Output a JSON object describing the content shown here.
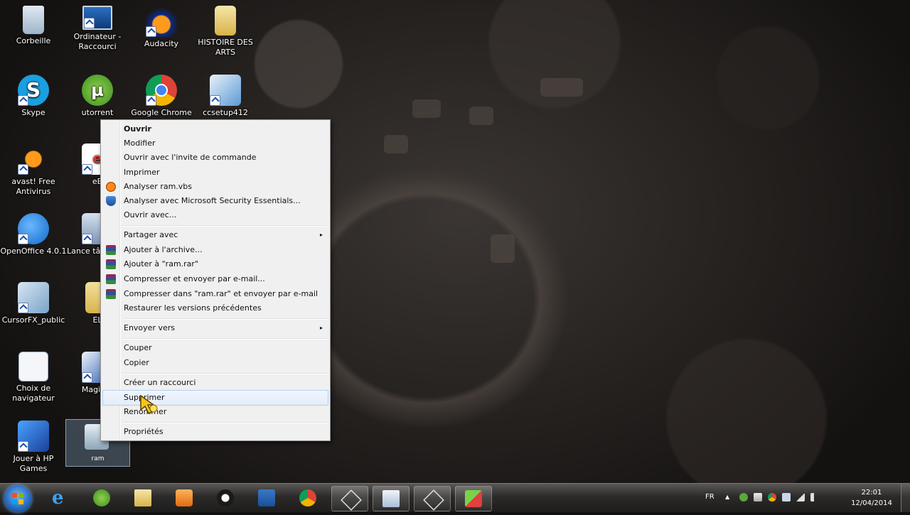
{
  "desktop": {
    "icons": [
      {
        "label": "Corbeille"
      },
      {
        "label": "Ordinateur - Raccourci"
      },
      {
        "label": "Audacity"
      },
      {
        "label": "HISTOIRE DES ARTS"
      },
      {
        "label": "Skype"
      },
      {
        "label": "utorrent"
      },
      {
        "label": "Google Chrome"
      },
      {
        "label": "ccsetup412"
      },
      {
        "label": "avast! Free Antivirus"
      },
      {
        "label": "eB"
      },
      {
        "label": "OpenOffice 4.0.1"
      },
      {
        "label": "Lance tâches M"
      },
      {
        "label": "CursorFX_public"
      },
      {
        "label": "EL"
      },
      {
        "label": "Choix de navigateur"
      },
      {
        "label": "Magic D"
      },
      {
        "label": "Jouer à HP Games"
      },
      {
        "label": "ram"
      }
    ]
  },
  "context_menu": {
    "items": [
      {
        "label": "Ouvrir"
      },
      {
        "label": "Modifier"
      },
      {
        "label": "Ouvrir avec l'invite de commande"
      },
      {
        "label": "Imprimer"
      },
      {
        "label": "Analyser ram.vbs"
      },
      {
        "label": "Analyser avec Microsoft Security Essentials..."
      },
      {
        "label": "Ouvrir avec..."
      },
      {
        "label": "Partager avec"
      },
      {
        "label": "Ajouter à l'archive..."
      },
      {
        "label": "Ajouter à \"ram.rar\""
      },
      {
        "label": "Compresser et envoyer par e-mail..."
      },
      {
        "label": "Compresser dans \"ram.rar\" et envoyer par e-mail"
      },
      {
        "label": "Restaurer les versions précédentes"
      },
      {
        "label": "Envoyer vers"
      },
      {
        "label": "Couper"
      },
      {
        "label": "Copier"
      },
      {
        "label": "Créer un raccourci"
      },
      {
        "label": "Supprimer"
      },
      {
        "label": "Renommer"
      },
      {
        "label": "Propriétés"
      }
    ],
    "submenu_arrow": "▸"
  },
  "taskbar": {
    "language": "FR",
    "time": "22:01",
    "date": "12/04/2014"
  }
}
